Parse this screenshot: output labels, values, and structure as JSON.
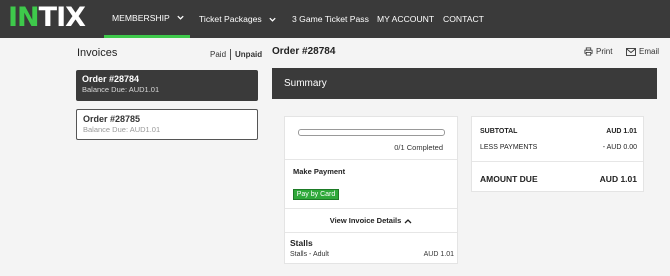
{
  "brand": {
    "logo_green": "IN",
    "logo_white": "TIX",
    "accent": "#3ec94b"
  },
  "nav": {
    "membership": "MEMBERSHIP",
    "ticket_packages": "Ticket Packages",
    "three_game": "3 Game Ticket Pass",
    "my_account": "MY ACCOUNT",
    "contact": "CONTACT"
  },
  "invoices": {
    "title": "Invoices",
    "filter_paid": "Paid",
    "filter_unpaid": "Unpaid",
    "orders": [
      {
        "number": "Order #28784",
        "balance": "Balance Due: AUD1.01"
      },
      {
        "number": "Order #28785",
        "balance": "Balance Due: AUD1.01"
      }
    ]
  },
  "order": {
    "title": "Order #28784",
    "print_label": "Print",
    "email_label": "Email",
    "summary_title": "Summary",
    "progress_fraction": 0,
    "progress_text": "0/1 Completed",
    "make_payment": "Make Payment",
    "pay_button": "Pay by Card",
    "view_details": "View Invoice Details",
    "line_group": "Stalls",
    "line_item": {
      "name": "Stalls - Adult",
      "amount": "AUD 1.01"
    },
    "totals": {
      "subtotal_label": "SUBTOTAL",
      "subtotal_value": "AUD 1.01",
      "payments_label": "LESS PAYMENTS",
      "payments_value": "- AUD 0.00",
      "due_label": "AMOUNT DUE",
      "due_value": "AUD 1.01"
    }
  }
}
